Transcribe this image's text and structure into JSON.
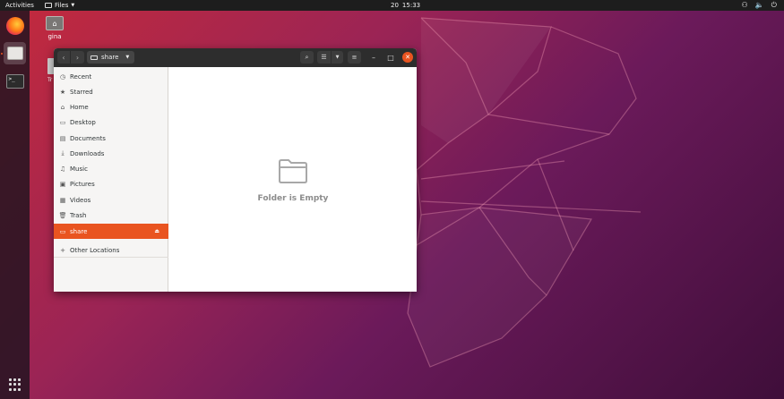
{
  "topbar": {
    "activities": "Activities",
    "app_menu": "Files",
    "clock_day": "20",
    "clock_time": "15:33",
    "tray_network": "⚇",
    "tray_volume": "🔈",
    "tray_power": "⏻"
  },
  "desktop": {
    "home_label": "gina",
    "trash_label": "Tr"
  },
  "window": {
    "location": "share",
    "nav_back": "‹",
    "nav_forward": "›",
    "search_icon": "⌕",
    "view_icon": "☰",
    "menu_icon": "≡",
    "minimize": "–",
    "maximize": "□",
    "close": "✕"
  },
  "sidebar": {
    "items": [
      {
        "label": "Recent",
        "icon": "clock-icon",
        "glyph": "◷"
      },
      {
        "label": "Starred",
        "icon": "star-icon",
        "glyph": "★"
      },
      {
        "label": "Home",
        "icon": "home-icon",
        "glyph": "⌂"
      },
      {
        "label": "Desktop",
        "icon": "desktop-icon",
        "glyph": "▭"
      },
      {
        "label": "Documents",
        "icon": "document-icon",
        "glyph": "▤"
      },
      {
        "label": "Downloads",
        "icon": "download-icon",
        "glyph": "⤓"
      },
      {
        "label": "Music",
        "icon": "music-icon",
        "glyph": "♫"
      },
      {
        "label": "Pictures",
        "icon": "picture-icon",
        "glyph": "▣"
      },
      {
        "label": "Videos",
        "icon": "video-icon",
        "glyph": "▦"
      },
      {
        "label": "Trash",
        "icon": "trash-icon",
        "glyph": "🗑"
      },
      {
        "label": "share",
        "icon": "drive-icon",
        "glyph": "▭",
        "selected": true
      },
      {
        "label": "Other Locations",
        "icon": "plus-icon",
        "glyph": "+"
      }
    ],
    "eject_glyph": "⏏"
  },
  "main": {
    "empty_text": "Folder is Empty"
  },
  "colors": {
    "accent": "#e95420",
    "headerbar": "#2d2d2d",
    "sidebar_bg": "#f6f5f4"
  }
}
